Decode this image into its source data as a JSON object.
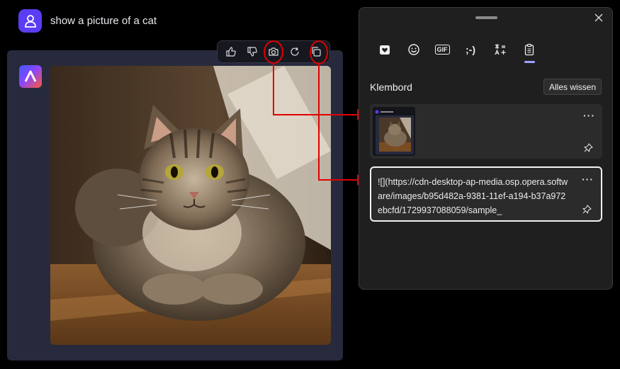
{
  "chat": {
    "user_prompt": "show a picture of a cat"
  },
  "toolbar": {
    "icons": [
      "thumbs-up-icon",
      "thumbs-down-icon",
      "camera-icon",
      "refresh-icon",
      "copy-icon"
    ]
  },
  "clipboard_panel": {
    "tabs": [
      {
        "name": "favorites-icon"
      },
      {
        "name": "emoji-icon"
      },
      {
        "name": "gif-icon",
        "label": "GIF"
      },
      {
        "name": "kaomoji-icon",
        "label": ";-)"
      },
      {
        "name": "symbols-icon"
      },
      {
        "name": "clipboard-icon",
        "active": true
      }
    ],
    "title": "Klembord",
    "clear_all_label": "Alles wissen",
    "items": [
      {
        "type": "image",
        "more_label": "···"
      },
      {
        "type": "text",
        "text": "![](https://cdn-desktop-ap-media.osp.opera.software/images/b95d482a-9381-11ef-a194-b37a972ebcfd/1729937088059/sample_",
        "more_label": "···"
      }
    ]
  },
  "annotations": {
    "color": "#e10000"
  }
}
